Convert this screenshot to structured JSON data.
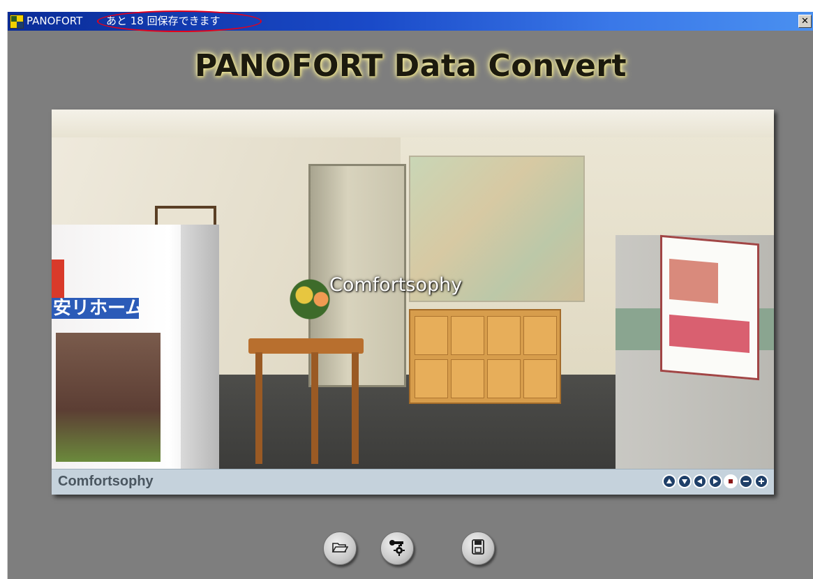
{
  "window": {
    "app_name": "PANOFORT",
    "save_message": "あと 18 回保存できます",
    "close_label": "✕"
  },
  "header": {
    "title": "PANOFORT Data Convert"
  },
  "viewer": {
    "overlay_logo": "Comfortsophy",
    "caption": "Comfortsophy",
    "nav_controls": [
      "up-icon",
      "down-icon",
      "left-icon",
      "right-icon",
      "stop-icon",
      "zoom-out-icon",
      "zoom-in-icon"
    ]
  },
  "toolbar": {
    "buttons": [
      "open-folder-icon",
      "settings-icon",
      "save-icon"
    ]
  }
}
